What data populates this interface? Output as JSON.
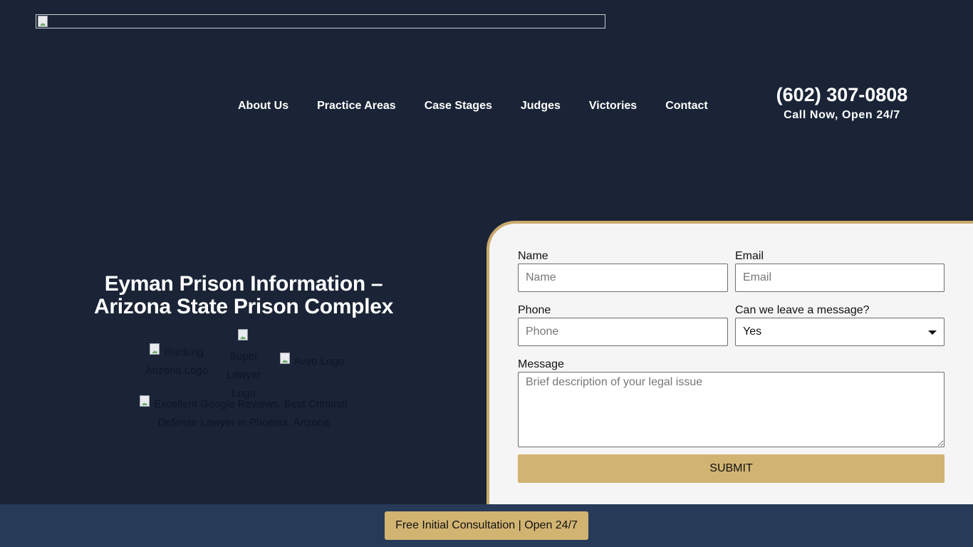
{
  "header": {
    "logo_alt": "",
    "nav": [
      {
        "label": "About Us"
      },
      {
        "label": "Practice Areas"
      },
      {
        "label": "Case Stages"
      },
      {
        "label": "Judges"
      },
      {
        "label": "Victories"
      },
      {
        "label": "Contact"
      }
    ],
    "phone": "(602) 307-0808",
    "phone_cta": "Call Now, Open 24/7"
  },
  "hero": {
    "title": "Eyman Prison Information – Arizona State Prison Complex"
  },
  "badges": {
    "ranking": "Ranking Arizona Logo",
    "super_lawyer": "Super Lawyer Logo",
    "avvo": "Avvo Logo",
    "google": "Excellent Google Reviews, Best Criminal Defense Lawyer in Phoenix, Arizona"
  },
  "form": {
    "name_label": "Name",
    "name_placeholder": "Name",
    "email_label": "Email",
    "email_placeholder": "Email",
    "phone_label": "Phone",
    "phone_placeholder": "Phone",
    "message_ok_label": "Can we leave a message?",
    "message_ok_value": "Yes",
    "message_label": "Message",
    "message_placeholder": "Brief description of your legal issue",
    "submit_label": "SUBMIT"
  },
  "footer_bar": {
    "consult_label": "Free Initial Consultation | Open 24/7"
  },
  "colors": {
    "background": "#1a2436",
    "accent_gold": "#d2b472",
    "panel_border": "#c9a96a",
    "bottom_bar": "#273a57"
  }
}
